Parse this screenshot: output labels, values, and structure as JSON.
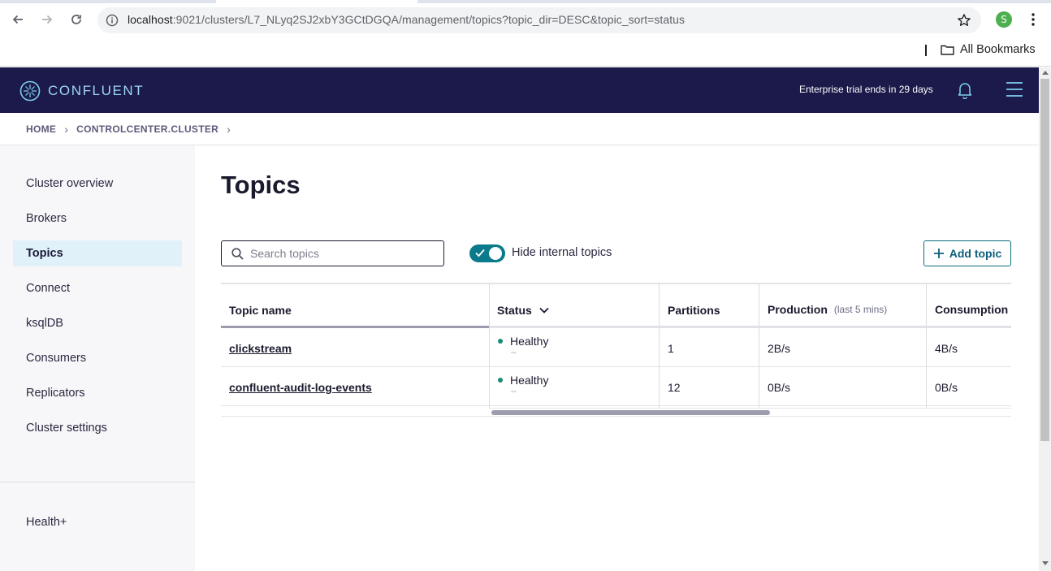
{
  "browser": {
    "url_host": "localhost",
    "url_rest": ":9021/clusters/L7_NLyq2SJ2xbY3GCtDGQA/management/topics?topic_dir=DESC&topic_sort=status",
    "profile_initial": "S",
    "bookmarks_label": "All Bookmarks"
  },
  "header": {
    "brand": "CONFLUENT",
    "trial_notice": "Enterprise trial ends in 29 days"
  },
  "breadcrumb": {
    "home": "HOME",
    "cluster": "CONTROLCENTER.CLUSTER"
  },
  "sidebar": {
    "items": [
      {
        "label": "Cluster overview"
      },
      {
        "label": "Brokers"
      },
      {
        "label": "Topics"
      },
      {
        "label": "Connect"
      },
      {
        "label": "ksqlDB"
      },
      {
        "label": "Consumers"
      },
      {
        "label": "Replicators"
      },
      {
        "label": "Cluster settings"
      }
    ],
    "footer_item": "Health+"
  },
  "main": {
    "title": "Topics",
    "search_placeholder": "Search topics",
    "toggle_label": "Hide internal topics",
    "add_button": "Add topic"
  },
  "table": {
    "columns": {
      "name": "Topic name",
      "status": "Status",
      "partitions": "Partitions",
      "production": "Production",
      "production_sub": "(last 5 mins)",
      "consumption": "Consumption"
    },
    "rows": [
      {
        "name": "clickstream",
        "status": "Healthy",
        "status_sub": "--",
        "partitions": "1",
        "production": "2B/s",
        "consumption": "4B/s"
      },
      {
        "name": "confluent-audit-log-events",
        "status": "Healthy",
        "status_sub": "--",
        "partitions": "12",
        "production": "0B/s",
        "consumption": "0B/s"
      }
    ]
  },
  "colors": {
    "header_bg": "#1b1a4a",
    "accent_teal": "#0b7a8a",
    "active_nav_bg": "#e1f1f9",
    "healthy_dot": "#1b8a7a"
  }
}
